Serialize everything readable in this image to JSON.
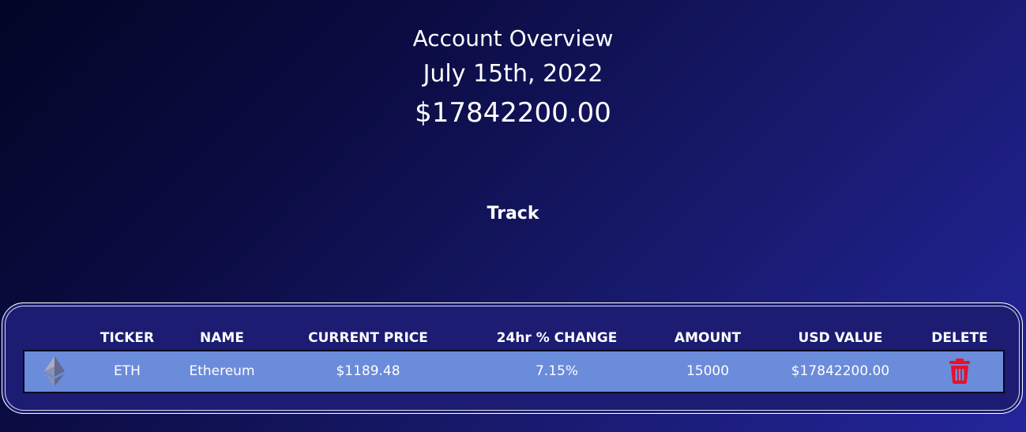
{
  "overview": {
    "title": "Account Overview",
    "date": "July 15th, 2022",
    "total": "$17842200.00"
  },
  "section": {
    "label": "Track"
  },
  "table": {
    "columns": [
      "TICKER",
      "NAME",
      "CURRENT PRICE",
      "24hr % CHANGE",
      "AMOUNT",
      "USD VALUE",
      "DELETE"
    ],
    "rows": [
      {
        "icon": "ethereum-icon",
        "ticker": "ETH",
        "name": "Ethereum",
        "price": "$1189.48",
        "change": "7.15%",
        "amount": "15000",
        "usd_value": "$17842200.00",
        "delete_icon": "trash-icon"
      }
    ]
  },
  "colors": {
    "background_start": "#020526",
    "background_end": "#24259a",
    "panel": "#1b1c72",
    "row": "#6b8bdb",
    "delete": "#e8102a"
  }
}
